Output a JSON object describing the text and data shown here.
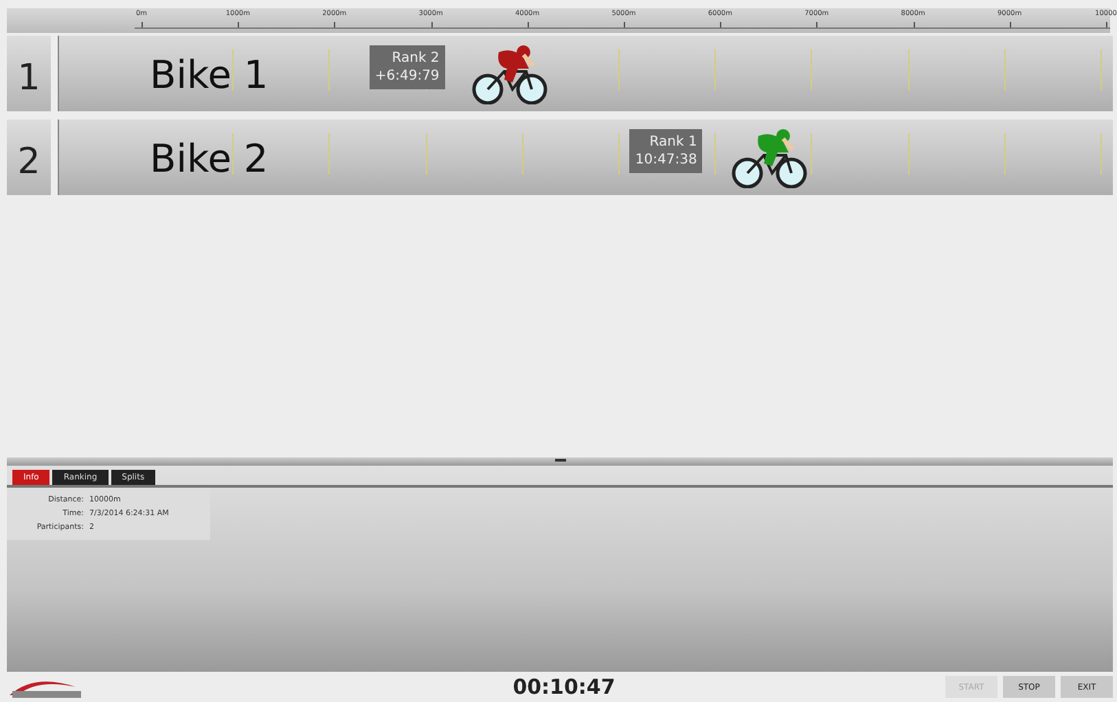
{
  "ruler": {
    "labels": [
      "0m",
      "1000m",
      "2000m",
      "3000m",
      "4000m",
      "5000m",
      "6000m",
      "7000m",
      "8000m",
      "9000m",
      "10000"
    ]
  },
  "lanes": [
    {
      "number": "1",
      "name": "Bike 1",
      "rank": "Rank 2",
      "time": "+6:49:79",
      "level": 0.43,
      "color": "#b01818"
    },
    {
      "number": "2",
      "name": "Bike 2",
      "rank": "Rank 1",
      "time": "10:47:38",
      "level": 0.7,
      "color": "#1f9a1f"
    }
  ],
  "panel": {
    "tabs": [
      {
        "label": "Info",
        "selected": true
      },
      {
        "label": "Ranking",
        "selected": false
      },
      {
        "label": "Splits",
        "selected": false
      }
    ],
    "info": [
      {
        "label": "Distance:",
        "value": "10000m"
      },
      {
        "label": "Time:",
        "value": "7/3/2014 6:24:31 AM"
      },
      {
        "label": "Participants:",
        "value": "2"
      }
    ]
  },
  "footer": {
    "clock": "00:10:47",
    "buttons": [
      {
        "label": "START",
        "disabled": true
      },
      {
        "label": "STOP",
        "disabled": false
      },
      {
        "label": "EXIT",
        "disabled": false
      }
    ]
  }
}
